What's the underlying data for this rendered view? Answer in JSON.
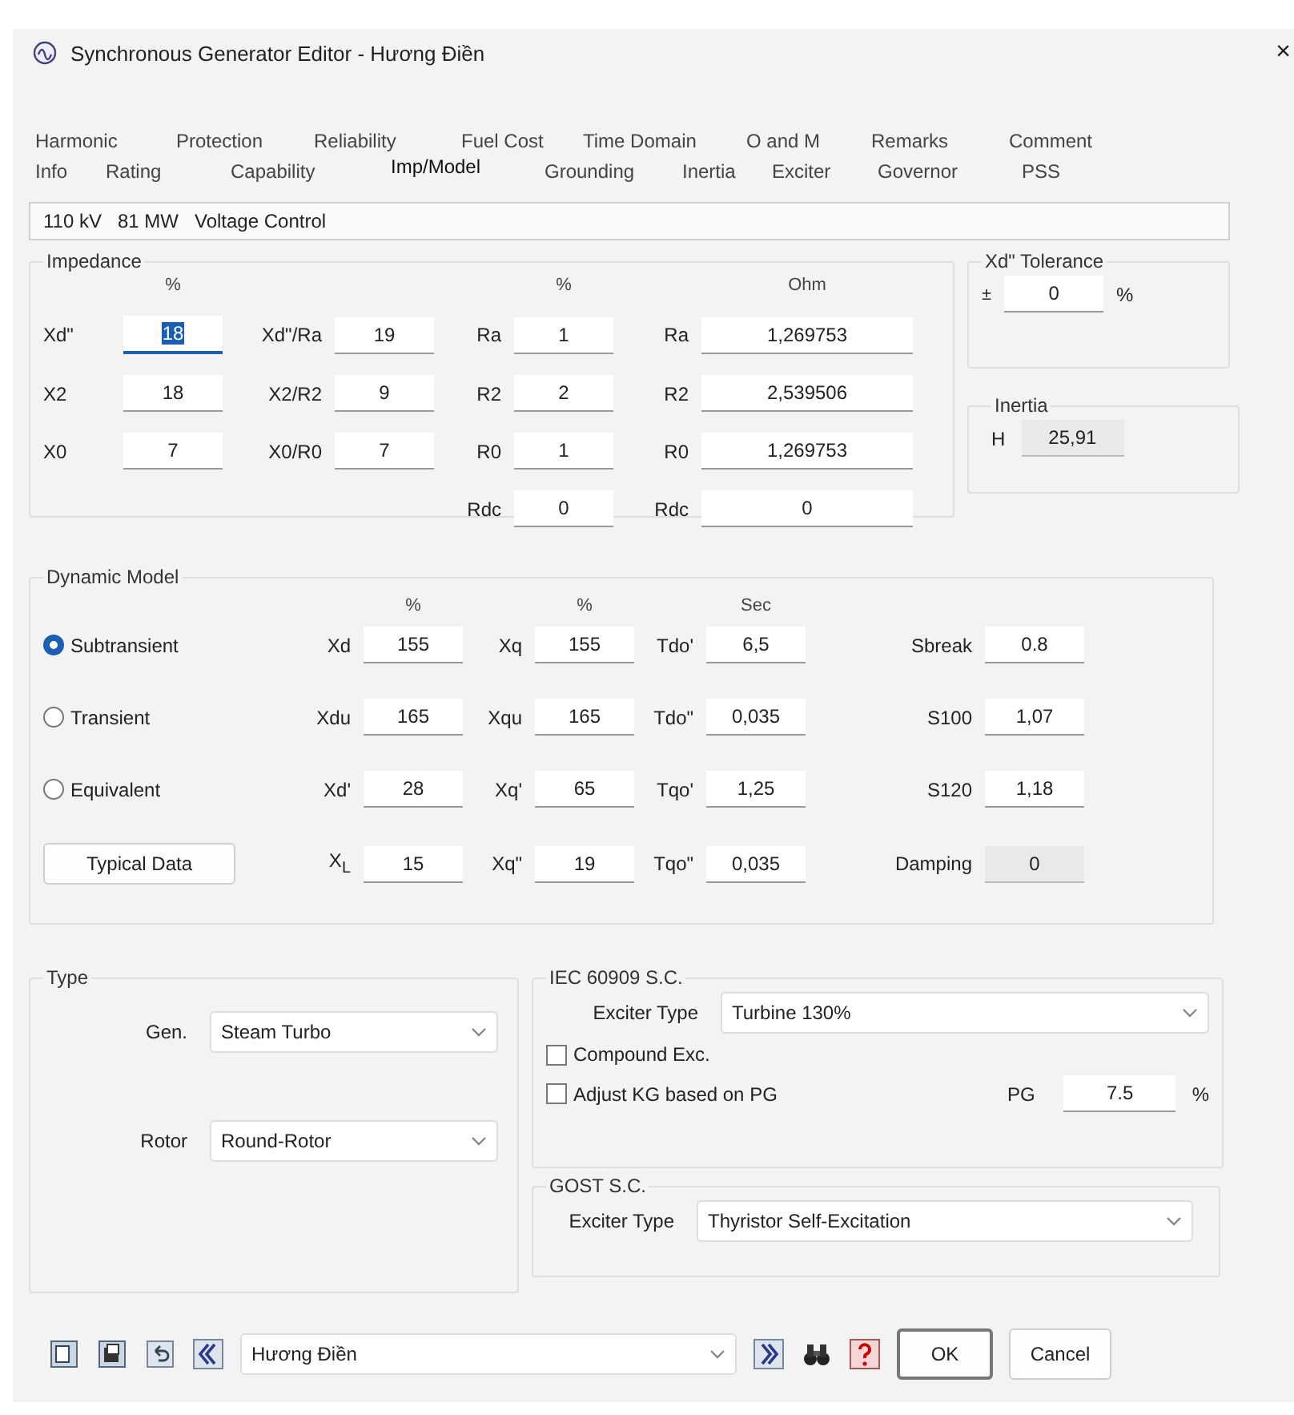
{
  "window": {
    "title": "Synchronous Generator Editor - Hương  Điền",
    "close": "×"
  },
  "tabs": [
    [
      {
        "label": "Harmonic",
        "selected": false
      },
      {
        "label": "Protection",
        "selected": false
      },
      {
        "label": "Reliability",
        "selected": false
      },
      {
        "label": "Fuel Cost",
        "selected": false
      },
      {
        "label": "Time Domain",
        "selected": false
      },
      {
        "label": "O and M",
        "selected": false
      },
      {
        "label": "Remarks",
        "selected": false
      },
      {
        "label": "Comment",
        "selected": false
      }
    ],
    [
      {
        "label": "Info",
        "selected": false
      },
      {
        "label": "Rating",
        "selected": false
      },
      {
        "label": "Capability",
        "selected": false
      },
      {
        "label": "Imp/Model",
        "selected": true
      },
      {
        "label": "Grounding",
        "selected": false
      },
      {
        "label": "Inertia",
        "selected": false
      },
      {
        "label": "Exciter",
        "selected": false
      },
      {
        "label": "Governor",
        "selected": false
      },
      {
        "label": "PSS",
        "selected": false
      }
    ]
  ],
  "info_bar": [
    "110 kV",
    "81 MW",
    "Voltage Control"
  ],
  "impedance": {
    "title": "Impedance",
    "headers": {
      "reactance": "%",
      "resistance": "%",
      "ohm": "Ohm"
    },
    "rows": [
      [
        {
          "label": "Xd\"",
          "value": "18",
          "focused": true
        },
        {
          "label": "Xd\"/Ra",
          "value": "19",
          "focused": false
        },
        {
          "label": "Ra",
          "value": "1",
          "focused": false
        },
        {
          "label": "Ra",
          "value": "1,269753",
          "focused": false
        }
      ],
      [
        {
          "label": "X2",
          "value": "18",
          "focused": false
        },
        {
          "label": "X2/R2",
          "value": "9",
          "focused": false
        },
        {
          "label": "R2",
          "value": "2",
          "focused": false
        },
        {
          "label": "R2",
          "value": "2,539506",
          "focused": false
        }
      ],
      [
        {
          "label": "X0",
          "value": "7",
          "focused": false
        },
        {
          "label": "X0/R0",
          "value": "7",
          "focused": false
        },
        {
          "label": "R0",
          "value": "1",
          "focused": false
        },
        {
          "label": "R0",
          "value": "1,269753",
          "focused": false
        }
      ],
      [
        null,
        null,
        {
          "label": "Rdc",
          "value": "0",
          "focused": false
        },
        {
          "label": "Rdc",
          "value": "0",
          "focused": false
        }
      ]
    ]
  },
  "tolerance": {
    "title": "Xd\" Tolerance",
    "sign": "±",
    "value": "0",
    "unit": "%"
  },
  "inertia": {
    "title": "Inertia",
    "label": "H",
    "value": "25,91",
    "disabled": true
  },
  "dynamic": {
    "title": "Dynamic Model",
    "headers": {
      "d_axis": "%",
      "q_axis": "%",
      "time": "Sec"
    },
    "modes": [
      {
        "label": "Subtransient",
        "selected": true
      },
      {
        "label": "Transient",
        "selected": false
      },
      {
        "label": "Equivalent",
        "selected": false
      }
    ],
    "button": "Typical Data",
    "rows": [
      [
        {
          "label": "Xd",
          "value": "155",
          "disabled": false
        },
        {
          "label": "Xq",
          "value": "155",
          "disabled": false
        },
        {
          "label": "Tdo'",
          "value": "6,5",
          "disabled": false
        },
        {
          "label": "Sbreak",
          "value": "0.8",
          "disabled": false
        }
      ],
      [
        {
          "label": "Xdu",
          "value": "165",
          "disabled": false
        },
        {
          "label": "Xqu",
          "value": "165",
          "disabled": false
        },
        {
          "label": "Tdo\"",
          "value": "0,035",
          "disabled": false
        },
        {
          "label": "S100",
          "value": "1,07",
          "disabled": false
        }
      ],
      [
        {
          "label": "Xd'",
          "value": "28",
          "disabled": false
        },
        {
          "label": "Xq'",
          "value": "65",
          "disabled": false
        },
        {
          "label": "Tqo'",
          "value": "1,25",
          "disabled": false
        },
        {
          "label": "S120",
          "value": "1,18",
          "disabled": false
        }
      ],
      [
        {
          "label": "X$_{L}$",
          "value": "15",
          "disabled": false
        },
        {
          "label": "Xq\"",
          "value": "19",
          "disabled": false
        },
        {
          "label": "Tqo\"",
          "value": "0,035",
          "disabled": false
        },
        {
          "label": "Damping",
          "value": "0",
          "disabled": true
        }
      ]
    ]
  },
  "type": {
    "title": "Type",
    "fields": [
      {
        "label": "Gen.",
        "value": "Steam Turbo"
      },
      {
        "label": "Rotor",
        "value": "Round-Rotor"
      }
    ]
  },
  "iec": {
    "title": "IEC 60909 S.C.",
    "exciter_label": "Exciter Type",
    "exciter": "Turbine 130%",
    "checks": [
      {
        "label": "Compound Exc.",
        "checked": false
      },
      {
        "label": "Adjust KG based on PG",
        "checked": false
      }
    ],
    "pg_label": "PG",
    "pg": "7.5",
    "pg_unit": "%"
  },
  "gost": {
    "title": "GOST S.C.",
    "exciter_label": "Exciter Type",
    "exciter": "Thyristor Self-Excitation"
  },
  "footer": {
    "record": "Hương Điền",
    "ok": "OK",
    "cancel": "Cancel"
  }
}
